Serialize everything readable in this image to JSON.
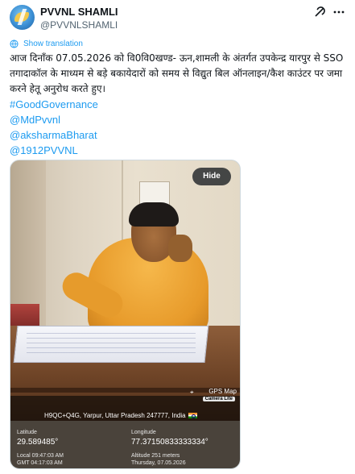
{
  "account": {
    "name": "PVVNL SHAMLI",
    "handle": "@PVVNLSHAMLI",
    "avatar_icon": "pvvnl-logo"
  },
  "post_actions": {
    "grok_icon": "grok-icon",
    "more_icon": "more-options-icon"
  },
  "translate": {
    "label": "Show translation",
    "icon": "translate-icon"
  },
  "tweet": {
    "text": "आज दिनाँक 07.05.2026 को वि0वि0खण्ड- ऊन,शामली के अंतर्गत उपकेन्द्र यारपुर से SSO तगादाकॉल के माध्यम से बड़े बकायेदारों को समय से विद्युत बिल ऑनलाइन/कैश काउंटर पर जमा करने हेतू अनुरोध करते हुए।",
    "tags": [
      "#GoodGovernance",
      "@MdPvvnl",
      "@aksharmaBharat",
      "@1912PVVNL"
    ]
  },
  "media": {
    "hide_label": "Hide",
    "gps_app": "GPS Map",
    "gps_app_sub": "Camera Lite",
    "address": "H9QC+Q4G, Yarpur, Uttar Pradesh 247777, India",
    "latitude_label": "Latitude",
    "latitude_value": "29.589485°",
    "longitude_label": "Longitude",
    "longitude_value": "77.37150833333334°",
    "local_time": "Local 09:47:03 AM",
    "gmt_time": "GMT 04:17:03 AM",
    "altitude": "Altitude 251 meters",
    "date": "Thursday, 07.05.2026"
  }
}
